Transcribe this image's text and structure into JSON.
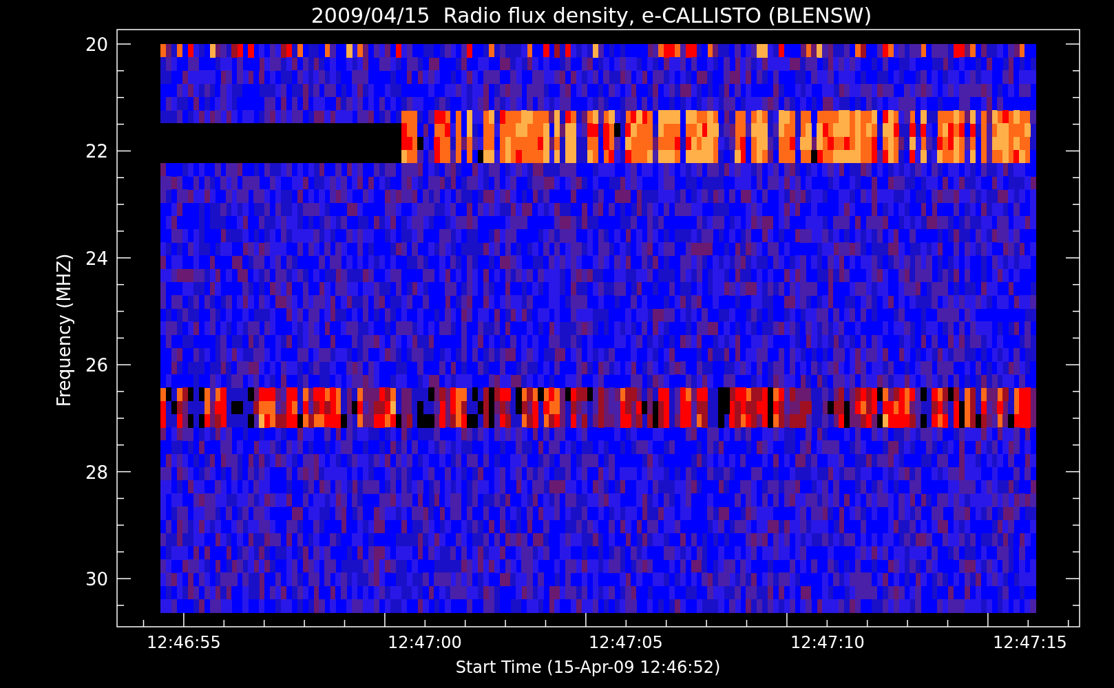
{
  "title": "2009/04/15  Radio flux density, e-CALLISTO (BLENSW)",
  "ylabel": "Frequency (MHZ)",
  "xlabel": "Start Time (15-Apr-09 12:46:52)",
  "yticks": [
    "20",
    "22",
    "24",
    "26",
    "28",
    "30"
  ],
  "xticks": [
    "12:46:55",
    "12:47:00",
    "12:47:05",
    "12:47:10",
    "12:47:15"
  ]
}
